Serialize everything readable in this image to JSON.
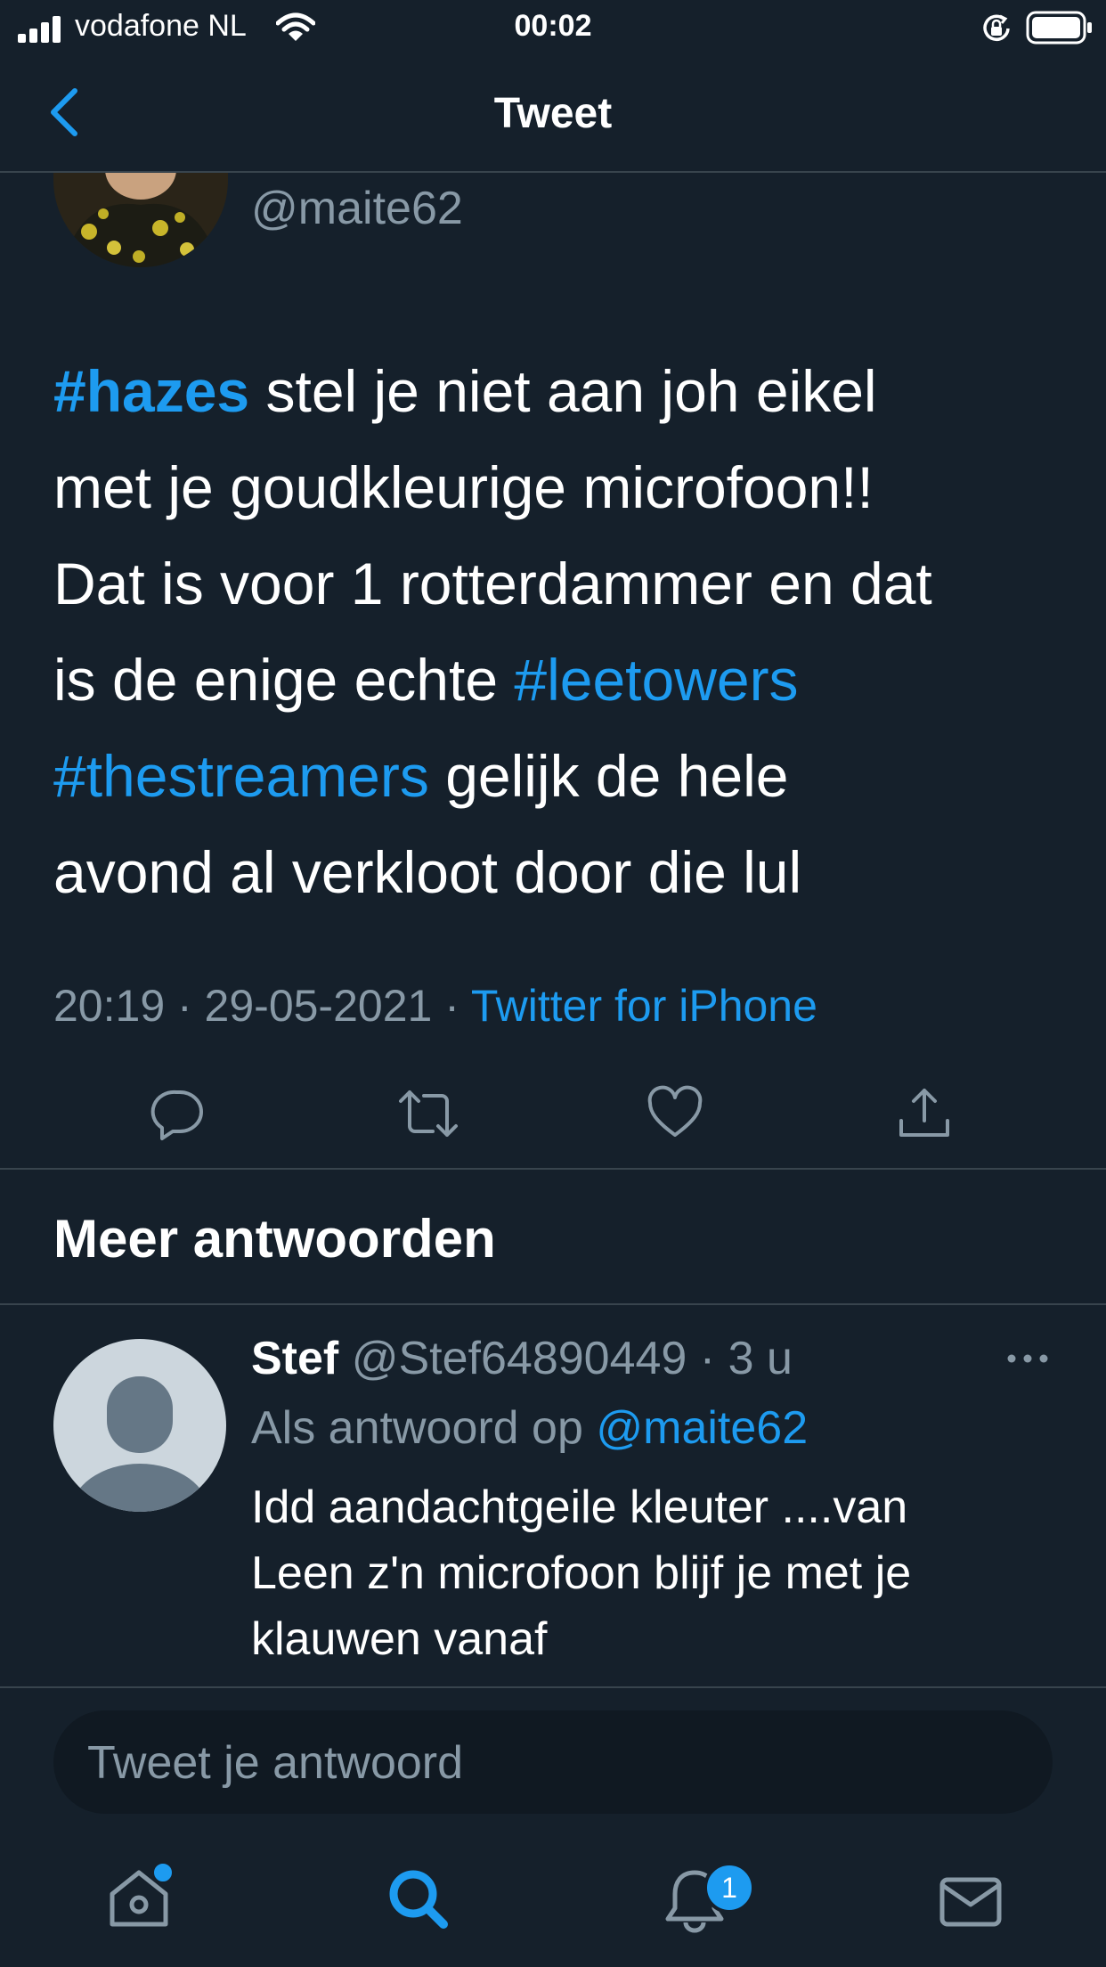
{
  "status_bar": {
    "carrier": "vodafone NL",
    "time": "00:02"
  },
  "header": {
    "title": "Tweet"
  },
  "tweet": {
    "handle": "@maite62",
    "text_lines": [
      {
        "tag": "#hazes",
        "text": " stel je niet aan joh eikel"
      },
      {
        "text": "met je goudkleurige microfoon!!"
      },
      {
        "text": "Dat is voor 1 rotterdammer en dat"
      },
      {
        "text": "is de enige echte ",
        "tag": "#leetowers"
      },
      {
        "tag": "#thestreamers",
        "text": " gelijk de hele"
      },
      {
        "text": "avond al verkloot door die lul"
      }
    ],
    "timestamp": "20:19 · 29-05-2021 · ",
    "source": "Twitter for iPhone"
  },
  "more_replies": {
    "title": "Meer antwoorden"
  },
  "reply": {
    "name": "Stef",
    "handle": "@Stef64890449",
    "time": " · 3 u",
    "context_prefix": "Als antwoord op ",
    "mention": "@maite62",
    "text_lines": [
      "Idd aandachtgeile kleuter ....van",
      "Leen z'n microfoon blijf je met je",
      "klauwen vanaf"
    ]
  },
  "composer": {
    "placeholder": "Tweet je antwoord"
  },
  "tab_bar": {
    "notifications_count": "1"
  },
  "colors": {
    "background": "#15202b",
    "accent": "#1d9bf0",
    "secondary_text": "#8899a6",
    "divider": "#38444d"
  }
}
